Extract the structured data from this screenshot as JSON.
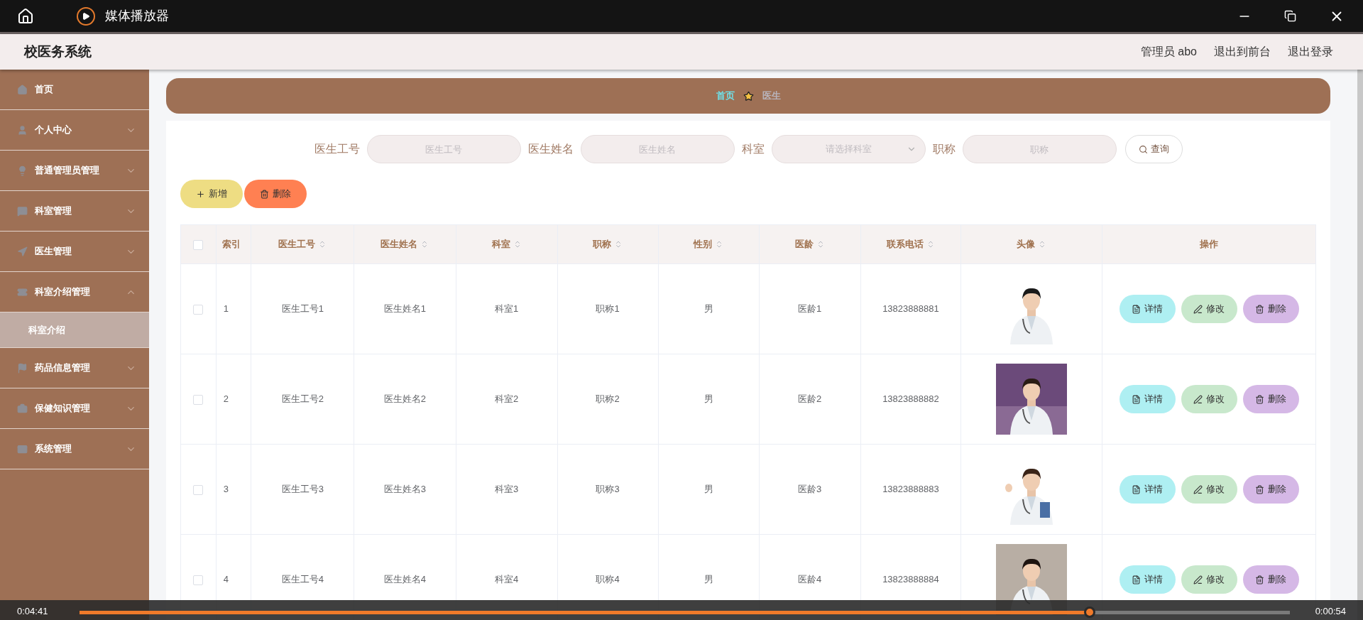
{
  "player": {
    "title": "媒体播放器",
    "time_elapsed": "0:04:41",
    "time_remaining": "0:00:54",
    "level": 0.835
  },
  "app": {
    "title": "校医务系统",
    "links": [
      "管理员 abo",
      "退出到前台",
      "退出登录"
    ]
  },
  "sidebar": {
    "items": [
      {
        "label": "首页",
        "kind": "link"
      },
      {
        "label": "个人中心",
        "kind": "menu",
        "expanded": false
      },
      {
        "label": "普通管理员管理",
        "kind": "menu",
        "expanded": false
      },
      {
        "label": "科室管理",
        "kind": "menu",
        "expanded": false
      },
      {
        "label": "医生管理",
        "kind": "menu",
        "expanded": false
      },
      {
        "label": "科室介绍管理",
        "kind": "menu",
        "expanded": true,
        "children": [
          {
            "label": "科室介绍",
            "selected": true
          }
        ]
      },
      {
        "label": "药品信息管理",
        "kind": "menu",
        "expanded": false
      },
      {
        "label": "保健知识管理",
        "kind": "menu",
        "expanded": false
      },
      {
        "label": "系统管理",
        "kind": "menu",
        "expanded": false
      }
    ]
  },
  "breadcrumb": [
    {
      "label": "首页",
      "selected": false
    },
    {
      "label": "医生",
      "selected": true
    }
  ],
  "search": {
    "fields": [
      {
        "label": "医生工号",
        "placeholder": "医生工号",
        "kind": "input"
      },
      {
        "label": "医生姓名",
        "placeholder": "医生姓名",
        "kind": "input"
      },
      {
        "label": "科室",
        "placeholder": "请选择科室",
        "kind": "select"
      },
      {
        "label": "职称",
        "placeholder": "职称",
        "kind": "input"
      }
    ],
    "button": "查询"
  },
  "actions": [
    {
      "label": "新增",
      "kind": "add"
    },
    {
      "label": "删除",
      "kind": "delete"
    }
  ],
  "table": {
    "select_all": {
      "checked": false
    },
    "columns": [
      {
        "label": "索引",
        "sortable": false
      },
      {
        "label": "医生工号",
        "sortable": true
      },
      {
        "label": "医生姓名",
        "sortable": true
      },
      {
        "label": "科室",
        "sortable": true
      },
      {
        "label": "职称",
        "sortable": true
      },
      {
        "label": "性别",
        "sortable": true
      },
      {
        "label": "医龄",
        "sortable": true
      },
      {
        "label": "联系电话",
        "sortable": true
      },
      {
        "label": "头像",
        "sortable": true
      },
      {
        "label": "操作",
        "sortable": false
      }
    ],
    "rows": [
      {
        "checked": false,
        "cells": [
          "1",
          "医生工号1",
          "医生姓名1",
          "科室1",
          "职称1",
          "男",
          "医龄1",
          "13823888881"
        ],
        "photo": {
          "kind": "picture"
        },
        "actions": [
          {
            "label": "详情",
            "kind": "detail"
          },
          {
            "label": "修改",
            "kind": "edit"
          },
          {
            "label": "删除",
            "kind": "delete"
          }
        ]
      },
      {
        "checked": false,
        "cells": [
          "2",
          "医生工号2",
          "医生姓名2",
          "科室2",
          "职称2",
          "男",
          "医龄2",
          "13823888882"
        ],
        "photo": {
          "kind": "picture"
        },
        "actions": [
          {
            "label": "详情",
            "kind": "detail"
          },
          {
            "label": "修改",
            "kind": "edit"
          },
          {
            "label": "删除",
            "kind": "delete"
          }
        ]
      },
      {
        "checked": false,
        "cells": [
          "3",
          "医生工号3",
          "医生姓名3",
          "科室3",
          "职称3",
          "男",
          "医龄3",
          "13823888883"
        ],
        "photo": {
          "kind": "picture"
        },
        "actions": [
          {
            "label": "详情",
            "kind": "detail"
          },
          {
            "label": "修改",
            "kind": "edit"
          },
          {
            "label": "删除",
            "kind": "delete"
          }
        ]
      },
      {
        "checked": false,
        "cells": [
          "4",
          "医生工号4",
          "医生姓名4",
          "科室4",
          "职称4",
          "男",
          "医龄4",
          "13823888884"
        ],
        "photo": {
          "kind": "picture"
        },
        "actions": [
          {
            "label": "详情",
            "kind": "detail"
          },
          {
            "label": "修改",
            "kind": "edit"
          },
          {
            "label": "删除",
            "kind": "delete"
          }
        ]
      }
    ]
  }
}
